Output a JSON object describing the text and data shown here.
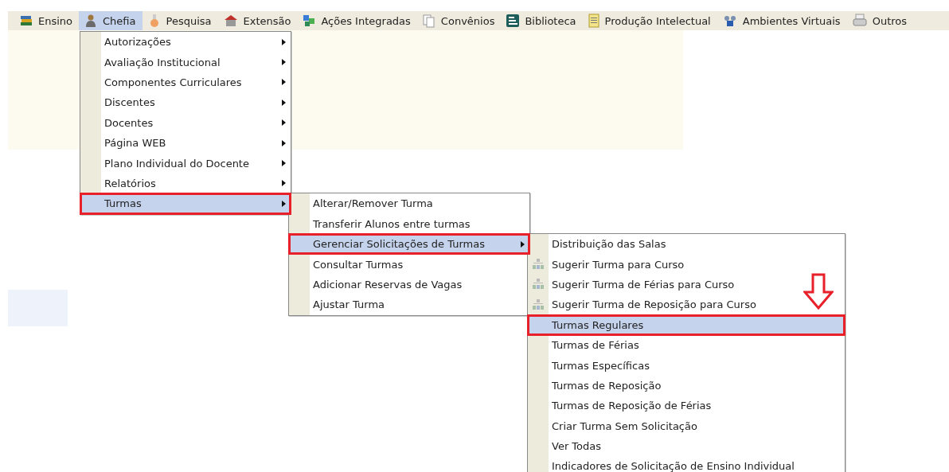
{
  "menubar": [
    {
      "label": "Ensino",
      "selected": false
    },
    {
      "label": "Chefia",
      "selected": true,
      "children": [
        {
          "label": "Autorizações",
          "has_submenu": true,
          "selected": false,
          "outlined": false,
          "kind": "plain"
        },
        {
          "label": "Avaliação Institucional",
          "has_submenu": true,
          "selected": false,
          "outlined": false,
          "kind": "plain"
        },
        {
          "label": "Componentes Curriculares",
          "has_submenu": true,
          "selected": false,
          "outlined": false,
          "kind": "plain"
        },
        {
          "label": "Discentes",
          "has_submenu": true,
          "selected": false,
          "outlined": false,
          "kind": "plain"
        },
        {
          "label": "Docentes",
          "has_submenu": true,
          "selected": false,
          "outlined": false,
          "kind": "plain"
        },
        {
          "label": "Página WEB",
          "has_submenu": true,
          "selected": false,
          "outlined": false,
          "kind": "plain"
        },
        {
          "label": "Plano Individual do Docente",
          "has_submenu": true,
          "selected": false,
          "outlined": false,
          "kind": "plain"
        },
        {
          "label": "Relatórios",
          "has_submenu": true,
          "selected": false,
          "outlined": false,
          "kind": "plain"
        },
        {
          "label": "Turmas",
          "has_submenu": true,
          "selected": true,
          "outlined": true,
          "kind": "plain",
          "children": [
            {
              "label": "Alterar/Remover Turma",
              "has_submenu": false,
              "selected": false,
              "outlined": false,
              "kind": "plain"
            },
            {
              "label": "Transferir Alunos entre turmas",
              "has_submenu": false,
              "selected": false,
              "outlined": false,
              "kind": "plain"
            },
            {
              "label": "Gerenciar Solicitações de Turmas",
              "has_submenu": true,
              "selected": true,
              "outlined": true,
              "kind": "plain",
              "children": [
                {
                  "label": "Distribuição das Salas",
                  "has_submenu": false,
                  "selected": false,
                  "outlined": false,
                  "kind": "plain"
                },
                {
                  "label": "Sugerir Turma para Curso",
                  "has_submenu": false,
                  "selected": false,
                  "outlined": false,
                  "kind": "icon"
                },
                {
                  "label": "Sugerir Turma de Férias para Curso",
                  "has_submenu": false,
                  "selected": false,
                  "outlined": false,
                  "kind": "icon"
                },
                {
                  "label": "Sugerir Turma de Reposição para Curso",
                  "has_submenu": false,
                  "selected": false,
                  "outlined": false,
                  "kind": "icon"
                },
                {
                  "label": "Turmas Regulares",
                  "has_submenu": false,
                  "selected": true,
                  "outlined": true,
                  "kind": "plain"
                },
                {
                  "label": "Turmas de Férias",
                  "has_submenu": false,
                  "selected": false,
                  "outlined": false,
                  "kind": "plain"
                },
                {
                  "label": "Turmas Específicas",
                  "has_submenu": false,
                  "selected": false,
                  "outlined": false,
                  "kind": "plain"
                },
                {
                  "label": "Turmas de Reposição",
                  "has_submenu": false,
                  "selected": false,
                  "outlined": false,
                  "kind": "plain"
                },
                {
                  "label": "Turmas de Reposição de Férias",
                  "has_submenu": false,
                  "selected": false,
                  "outlined": false,
                  "kind": "plain"
                },
                {
                  "label": "Criar Turma Sem Solicitação",
                  "has_submenu": false,
                  "selected": false,
                  "outlined": false,
                  "kind": "plain"
                },
                {
                  "label": "Ver Todas",
                  "has_submenu": false,
                  "selected": false,
                  "outlined": false,
                  "kind": "plain"
                },
                {
                  "label": "Indicadores de Solicitação de Ensino Individual",
                  "has_submenu": false,
                  "selected": false,
                  "outlined": false,
                  "kind": "plain"
                }
              ]
            },
            {
              "label": "Consultar Turmas",
              "has_submenu": false,
              "selected": false,
              "outlined": false,
              "kind": "plain"
            },
            {
              "label": "Adicionar Reservas de Vagas",
              "has_submenu": false,
              "selected": false,
              "outlined": false,
              "kind": "plain"
            },
            {
              "label": "Ajustar Turma",
              "has_submenu": false,
              "selected": false,
              "outlined": false,
              "kind": "plain"
            }
          ]
        }
      ]
    },
    {
      "label": "Pesquisa",
      "selected": false
    },
    {
      "label": "Extensão",
      "selected": false
    },
    {
      "label": "Ações Integradas",
      "selected": false
    },
    {
      "label": "Convênios",
      "selected": false
    },
    {
      "label": "Biblioteca",
      "selected": false
    },
    {
      "label": "Produção Intelectual",
      "selected": false
    },
    {
      "label": "Ambientes Virtuais",
      "selected": false
    },
    {
      "label": "Outros",
      "selected": false
    }
  ]
}
